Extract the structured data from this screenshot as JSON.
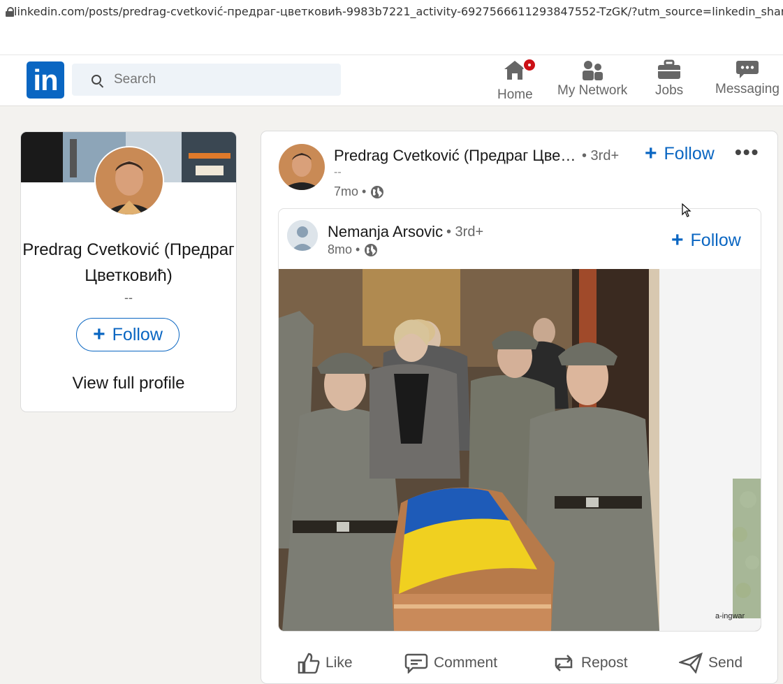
{
  "browser": {
    "url": "linkedin.com/posts/predrag-cvetković-предраг-цветковић-9983b7221_activity-6927566611293847552-TzGK/?utm_source=linkedin_share&u"
  },
  "header": {
    "logo_text": "in",
    "search_placeholder": "Search",
    "nav": [
      {
        "label": "Home",
        "icon": "home-icon",
        "has_badge": true
      },
      {
        "label": "My Network",
        "icon": "network-icon"
      },
      {
        "label": "Jobs",
        "icon": "briefcase-icon"
      },
      {
        "label": "Messaging",
        "icon": "messaging-icon"
      }
    ]
  },
  "profile_card": {
    "name": "Predrag Cvetković (Предраг Цветковић)",
    "headline": "--",
    "follow_label": "Follow",
    "view_profile_label": "View full profile"
  },
  "post": {
    "author": "Predrag Cvetković (Предраг Цве…",
    "degree": "• 3rd+",
    "headline": "--",
    "time": "7mo •",
    "follow_label": "Follow",
    "more_label": "•••",
    "shared": {
      "author": "Nemanja Arsovic",
      "degree": "• 3rd+",
      "time": "8mo •",
      "follow_label": "Follow",
      "image_watermark": "a-ingwar"
    },
    "actions": [
      {
        "label": "Like",
        "icon": "like-icon"
      },
      {
        "label": "Comment",
        "icon": "comment-icon"
      },
      {
        "label": "Repost",
        "icon": "repost-icon"
      },
      {
        "label": "Send",
        "icon": "send-icon"
      }
    ]
  },
  "colors": {
    "brand": "#0a66c2",
    "background": "#f3f2ef",
    "badge": "#cc1016",
    "flag_blue": "#1e5bb8",
    "flag_yellow": "#f0d020"
  }
}
